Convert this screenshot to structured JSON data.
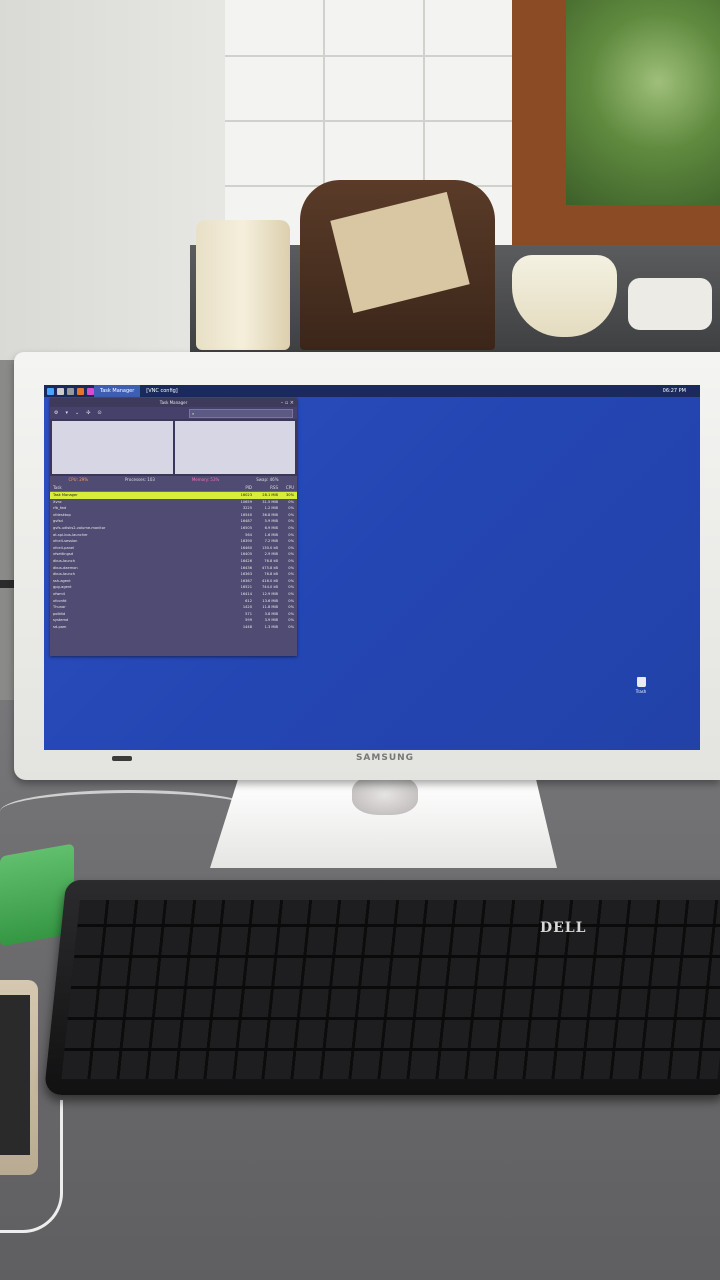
{
  "monitor": {
    "brand": "SAMSUNG"
  },
  "keyboard": {
    "brand": "DELL"
  },
  "desktop": {
    "taskbar": {
      "tasks": [
        "Task Manager",
        "[VNC config]"
      ],
      "clock": "06:27 PM"
    },
    "trash_label": "Trash"
  },
  "task_manager": {
    "title": "Task Manager",
    "stats": {
      "cpu": "CPU: 29%",
      "processes": "Processes: 103",
      "memory": "Memory: 53%",
      "swap": "Swap: 46%"
    },
    "columns": [
      "Task",
      "PID",
      "RSS",
      "CPU"
    ],
    "rows": [
      {
        "task": "Task Manager",
        "pid": "16023",
        "rss": "28.1 MiB",
        "cpu": "30%",
        "selected": true
      },
      {
        "task": "Xvnc",
        "pid": "10659",
        "rss": "31.5 MiB",
        "cpu": "0%"
      },
      {
        "task": "rfb_fwd",
        "pid": "3225",
        "rss": "1.2 MiB",
        "cpu": "0%"
      },
      {
        "task": "xfdesktop",
        "pid": "16540",
        "rss": "36.8 MiB",
        "cpu": "0%"
      },
      {
        "task": "gvfsd",
        "pid": "16487",
        "rss": "5.9 MiB",
        "cpu": "0%"
      },
      {
        "task": "gvfs-udisks2-volume-monitor",
        "pid": "16505",
        "rss": "6.9 MiB",
        "cpu": "0%"
      },
      {
        "task": "at-spi-bus-launcher",
        "pid": "564",
        "rss": "1.6 MiB",
        "cpu": "0%"
      },
      {
        "task": "xfce4-session",
        "pid": "16390",
        "rss": "7.2 MiB",
        "cpu": "0%"
      },
      {
        "task": "xfce4-panel",
        "pid": "16460",
        "rss": "130.0 kB",
        "cpu": "0%"
      },
      {
        "task": "xfsettingsd",
        "pid": "16405",
        "rss": "2.9 MiB",
        "cpu": "0%"
      },
      {
        "task": "dbus-launch",
        "pid": "16426",
        "rss": "76.8 kB",
        "cpu": "0%"
      },
      {
        "task": "dbus-daemon",
        "pid": "16436",
        "rss": "475.8 kB",
        "cpu": "0%"
      },
      {
        "task": "dbus-launch",
        "pid": "16363",
        "rss": "76.8 kB",
        "cpu": "0%"
      },
      {
        "task": "ssh-agent",
        "pid": "16367",
        "rss": "416.0 kB",
        "cpu": "0%"
      },
      {
        "task": "gpg-agent",
        "pid": "16521",
        "rss": "744.0 kB",
        "cpu": "0%"
      },
      {
        "task": "xfwm4",
        "pid": "16414",
        "rss": "12.9 MiB",
        "cpu": "0%"
      },
      {
        "task": "xfconfd",
        "pid": "612",
        "rss": "13.6 MiB",
        "cpu": "0%"
      },
      {
        "task": "Thunar",
        "pid": "1420",
        "rss": "11.8 MiB",
        "cpu": "0%"
      },
      {
        "task": "polkitd",
        "pid": "571",
        "rss": "3.8 MiB",
        "cpu": "0%"
      },
      {
        "task": "systemd",
        "pid": "599",
        "rss": "3.9 MiB",
        "cpu": "0%"
      },
      {
        "task": "sd-pam",
        "pid": "1448",
        "rss": "1.3 MiB",
        "cpu": "0%"
      }
    ]
  },
  "colors": {
    "desktop_background": "#2446b3",
    "task_manager_background": "#4f4b73",
    "selected_row": "#d8ec3a"
  }
}
